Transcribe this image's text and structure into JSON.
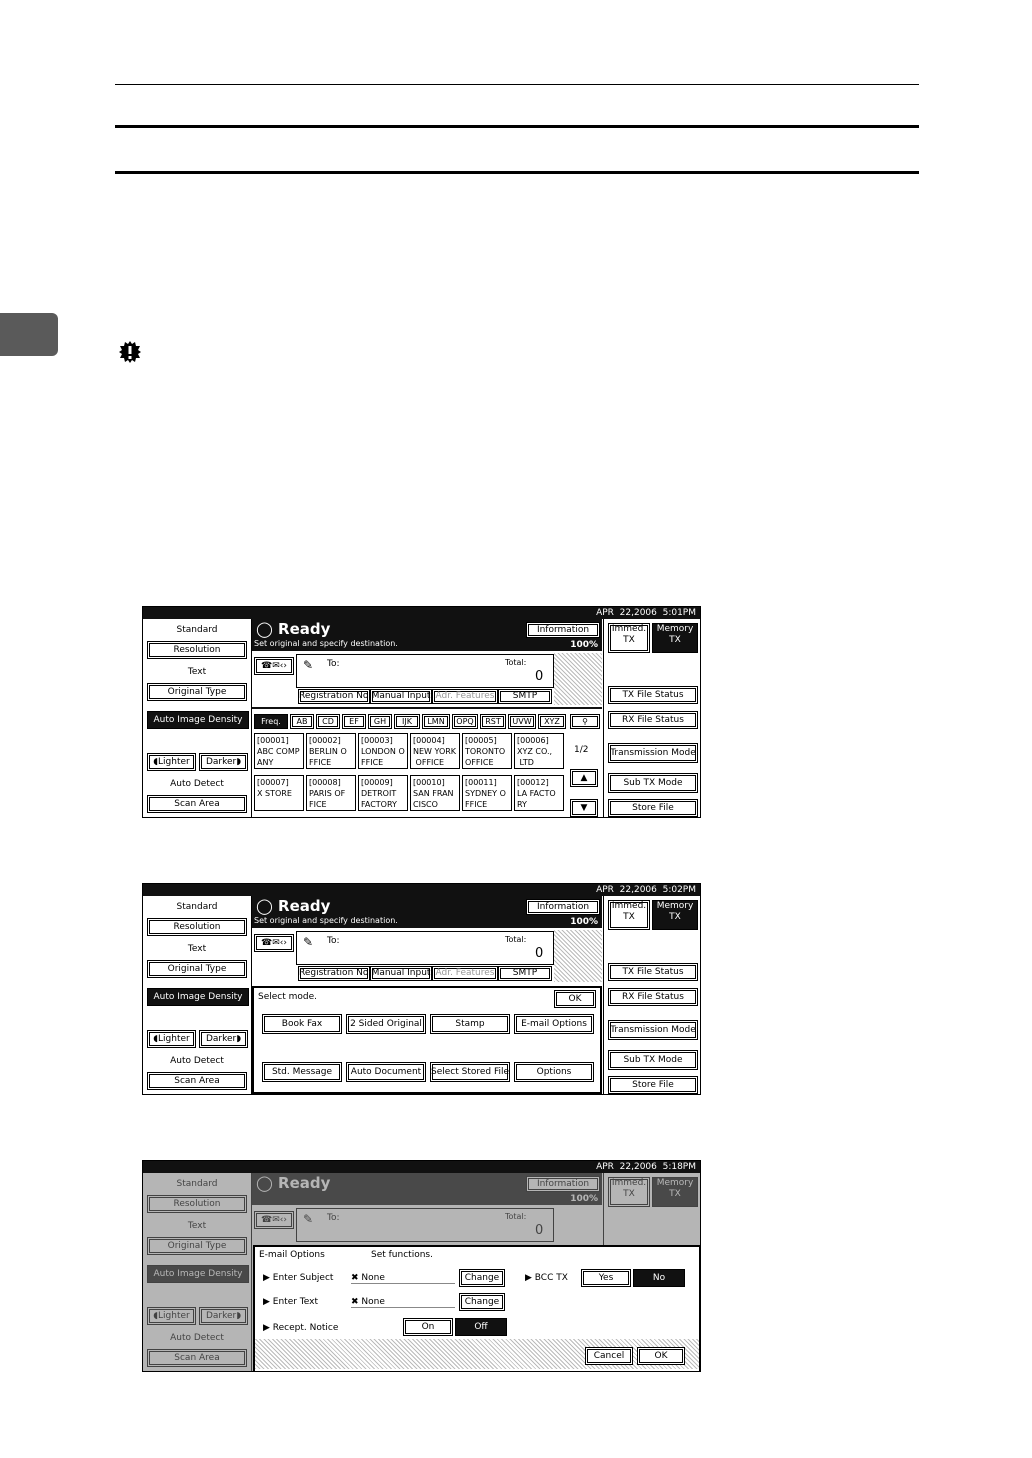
{
  "screens": [
    {
      "datetime": "APR  22,2006  5:01PM",
      "left": {
        "standard": "Standard",
        "resolution": "Resolution",
        "text": "Text",
        "original_type": "Original Type",
        "auto_density": "Auto Image Density",
        "lighter": "◖Lighter",
        "darker": "Darker◗",
        "auto_detect": "Auto Detect",
        "scan_area": "Scan Area"
      },
      "ready": "Ready",
      "subtitle": "Set original and specify destination.",
      "information": "Information",
      "percent": "100%",
      "to": "To:",
      "total": "Total:",
      "total_value": "0",
      "dest_tabs": [
        "Registration No.",
        "Manual Input",
        "Adr. Features",
        "SMTP"
      ],
      "right": {
        "immed": "Immed.\nTX",
        "memory": "Memory\nTX",
        "tx_status": "TX File Status",
        "rx_status": "RX File Status",
        "transmission": "Transmission Mode",
        "sub_tx": "Sub TX Mode",
        "store": "Store File"
      },
      "index_tabs": [
        "Freq.",
        "AB",
        "CD",
        "EF",
        "GH",
        "IJK",
        "LMN",
        "OPQ",
        "RST",
        "UVW",
        "XYZ"
      ],
      "page": "1/2",
      "addresses": [
        "[00001]\nABC COMP\nANY",
        "[00002]\nBERLIN O\nFFICE",
        "[00003]\nLONDON O\nFFICE",
        "[00004]\nNEW YORK\n OFFICE",
        "[00005]\nTORONTO\nOFFICE",
        "[00006]\nXYZ CO.,\n LTD",
        "[00007]\nX STORE",
        "[00008]\nPARIS OF\nFICE",
        "[00009]\nDETROIT\nFACTORY",
        "[00010]\nSAN FRAN\nCISCO",
        "[00011]\nSYDNEY O\nFFICE",
        "[00012]\nLA FACTO\nRY"
      ]
    },
    {
      "datetime": "APR  22,2006  5:02PM",
      "select_mode": "Select mode.",
      "ok": "OK",
      "modes": [
        "Book Fax",
        "2 Sided Original",
        "Stamp",
        "E-mail Options",
        "Std. Message",
        "Auto Document",
        "Select Stored File",
        "Options"
      ]
    },
    {
      "datetime": "APR  22,2006  5:18PM",
      "dialog_title": "E-mail Options",
      "dialog_hint": "Set functions.",
      "enter_subject": "▶ Enter Subject",
      "enter_text": "▶ Enter Text",
      "recept_notice": "▶ Recept. Notice",
      "none": "✖ None",
      "change": "Change",
      "bcc": "▶ BCC TX",
      "yes": "Yes",
      "no": "No",
      "on": "On",
      "off": "Off",
      "cancel": "Cancel",
      "ok": "OK"
    }
  ]
}
